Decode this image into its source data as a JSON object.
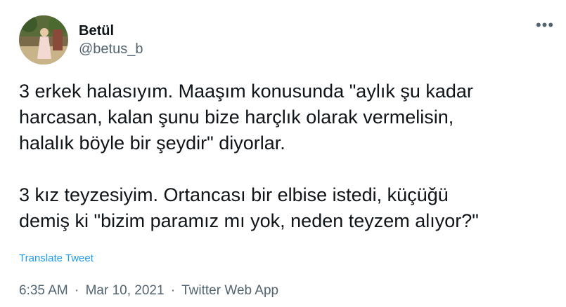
{
  "author": {
    "name": "Betül",
    "handle": "@betus_b"
  },
  "menu": {
    "more_label": "•••"
  },
  "tweet": {
    "lines_paragraph1": [
      "3 erkek halasıyım. Maaşım konusunda \"aylık şu kadar",
      "harcasan, kalan şunu bize harçlık olarak vermelisin,",
      "halalık böyle bir şeydir\" diyorlar."
    ],
    "lines_paragraph2": [
      "3 kız teyzesiyim. Ortancası bir elbise istedi, küçüğü",
      "demiş ki \"bizim paramız mı yok, neden teyzem alıyor?\""
    ],
    "translate_label": "Translate Tweet"
  },
  "meta": {
    "time": "6:35 AM",
    "separator": "·",
    "date": "Mar 10, 2021",
    "app": "Twitter Web App"
  },
  "colors": {
    "text": "#0f1419",
    "secondary": "#536471",
    "link": "#1d9bf0"
  }
}
